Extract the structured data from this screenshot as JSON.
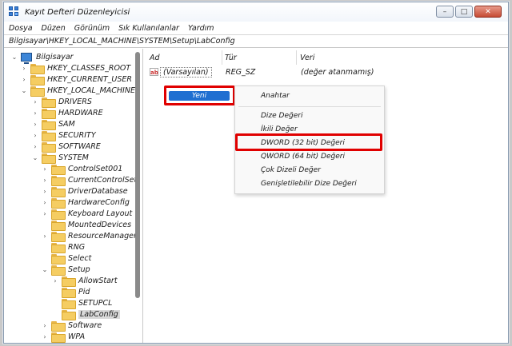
{
  "window": {
    "title": "Kayıt Defteri Düzenleyicisi",
    "controls": {
      "minimize": "–",
      "maximize": "□",
      "close": "✕"
    }
  },
  "menu": [
    "Dosya",
    "Düzen",
    "Görünüm",
    "Sık Kullanılanlar",
    "Yardım"
  ],
  "address": "Bilgisayar\\HKEY_LOCAL_MACHINE\\SYSTEM\\Setup\\LabConfig",
  "tree": {
    "root": "Bilgisayar",
    "hives": [
      "HKEY_CLASSES_ROOT",
      "HKEY_CURRENT_USER",
      "HKEY_LOCAL_MACHINE"
    ],
    "hklm_children": [
      "DRIVERS",
      "HARDWARE",
      "SAM",
      "SECURITY",
      "SOFTWARE",
      "SYSTEM"
    ],
    "system_children": [
      "ControlSet001",
      "CurrentControlSet",
      "DriverDatabase",
      "HardwareConfig",
      "Keyboard Layout",
      "MountedDevices",
      "ResourceManager",
      "RNG",
      "Select",
      "Setup"
    ],
    "setup_children": [
      "AllowStart",
      "Pid",
      "SETUPCL",
      "LabConfig"
    ],
    "after_setup": [
      "Software",
      "WPA"
    ],
    "selected": "LabConfig"
  },
  "list": {
    "columns": [
      "Ad",
      "Tür",
      "Veri"
    ],
    "rows": [
      {
        "name": "(Varsayılan)",
        "type": "REG_SZ",
        "data": "(değer atanmamış)",
        "icon": "ab"
      }
    ]
  },
  "context_menu": {
    "new_label": "Yeni",
    "submenu": [
      "Anahtar",
      "Dize Değeri",
      "İkili Değer",
      "DWORD (32 bit) Değeri",
      "QWORD (64 bit) Değeri",
      "Çok Dizeli Değer",
      "Genişletilebilir Dize Değeri"
    ],
    "highlighted": "DWORD (32 bit) Değeri"
  },
  "colors": {
    "highlight": "#e00000",
    "selection": "#1f6fd1",
    "folder": "#f5cd62"
  }
}
